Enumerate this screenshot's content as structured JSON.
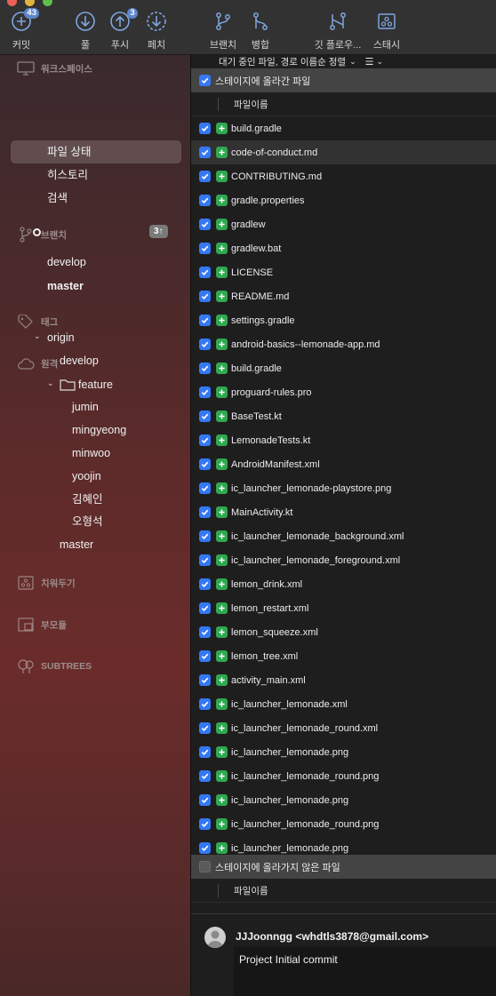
{
  "toolbar": {
    "buttons": [
      {
        "label": "커밋",
        "icon": "plus-circle-icon",
        "badge": "43"
      },
      {
        "label": "풀",
        "icon": "arrow-down-circle-icon",
        "badge": ""
      },
      {
        "label": "푸시",
        "icon": "arrow-up-circle-icon",
        "badge": "3"
      },
      {
        "label": "페치",
        "icon": "fetch-circle-icon",
        "badge": ""
      },
      {
        "label": "브랜치",
        "icon": "branch-icon",
        "badge": ""
      },
      {
        "label": "병합",
        "icon": "merge-icon",
        "badge": ""
      },
      {
        "label": "깃 플로우...",
        "icon": "git-flow-icon",
        "badge": ""
      },
      {
        "label": "스태시",
        "icon": "stash-icon",
        "badge": ""
      }
    ]
  },
  "sidebar": {
    "workspace": {
      "title": "워크스페이스",
      "items": [
        "파일 상태",
        "히스토리",
        "검색"
      ],
      "selected": "파일 상태"
    },
    "branches": {
      "title": "브랜치",
      "items": [
        "develop",
        "master"
      ],
      "current": "master",
      "ahead_badge": "3↑"
    },
    "tags": {
      "title": "태그"
    },
    "remotes": {
      "title": "원격",
      "origin": "origin",
      "origin_branches": [
        "develop"
      ],
      "feature_folder": "feature",
      "feature_items": [
        "jumin",
        "mingyeong",
        "minwoo",
        "yoojin",
        "김혜인",
        "오형석"
      ],
      "origin_after": [
        "master"
      ]
    },
    "stashes": {
      "title": "치워두기"
    },
    "submodules": {
      "title": "부모듈"
    },
    "subtrees": {
      "title": "SUBTREES"
    }
  },
  "main": {
    "sort_label": "대기 중인 파일, 경로 이름순 정렬",
    "staged_header": "스테이지에 올라간 파일",
    "column_header": "파일이름",
    "staged_files": [
      "build.gradle",
      "code-of-conduct.md",
      "CONTRIBUTING.md",
      "gradle.properties",
      "gradlew",
      "gradlew.bat",
      "LICENSE",
      "README.md",
      "settings.gradle",
      "android-basics--lemonade-app.md",
      "build.gradle",
      "proguard-rules.pro",
      "BaseTest.kt",
      "LemonadeTests.kt",
      "AndroidManifest.xml",
      "ic_launcher_lemonade-playstore.png",
      "MainActivity.kt",
      "ic_launcher_lemonade_background.xml",
      "ic_launcher_lemonade_foreground.xml",
      "lemon_drink.xml",
      "lemon_restart.xml",
      "lemon_squeeze.xml",
      "lemon_tree.xml",
      "activity_main.xml",
      "ic_launcher_lemonade.xml",
      "ic_launcher_lemonade_round.xml",
      "ic_launcher_lemonade.png",
      "ic_launcher_lemonade_round.png",
      "ic_launcher_lemonade.png",
      "ic_launcher_lemonade_round.png",
      "ic_launcher_lemonade.png"
    ],
    "unstaged_header": "스테이지에 올라가지 않은 파일",
    "unstaged_column_header": "파일이름"
  },
  "commit": {
    "author": "JJJoonngg <whdtls3878@gmail.com>",
    "message": "Project Initial commit"
  },
  "colors": {
    "accent": "#3478f6",
    "added": "#2fa84f",
    "badge": "#5c86c9"
  }
}
